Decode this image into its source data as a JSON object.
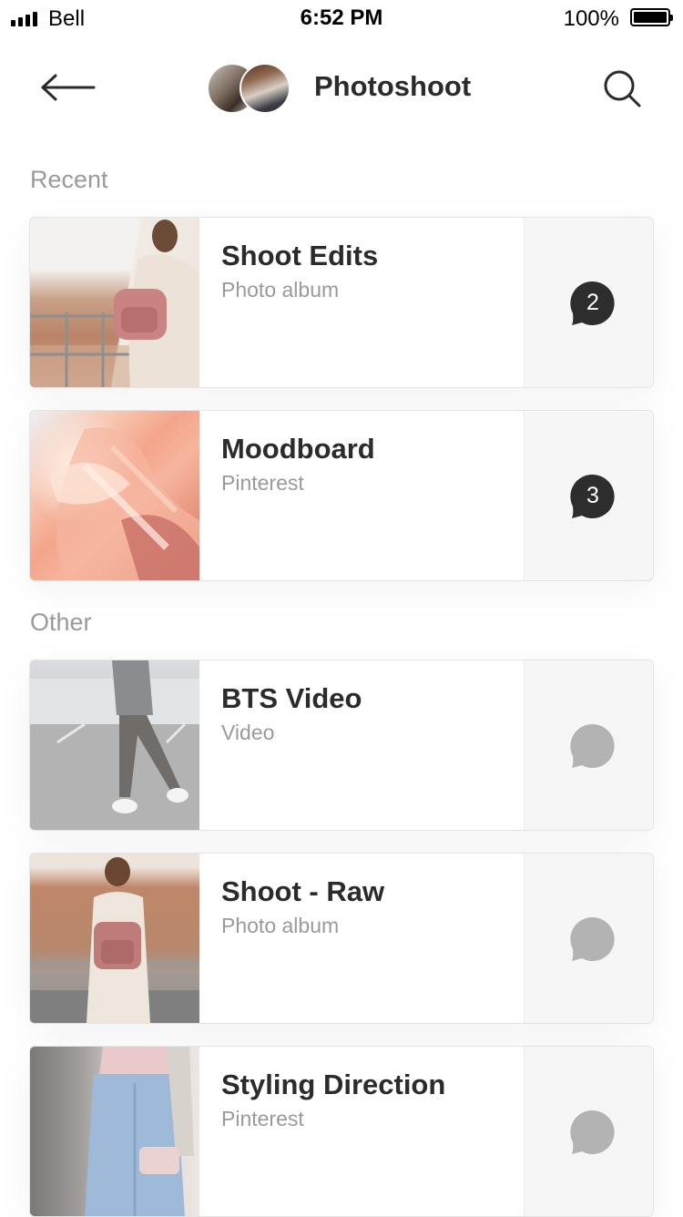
{
  "status_bar": {
    "carrier": "Bell",
    "time": "6:52 PM",
    "battery_percent_text": "100%",
    "battery_level": 1.0
  },
  "nav": {
    "back_icon": "arrow-left-icon",
    "title": "Photoshoot",
    "search_icon": "search-icon"
  },
  "sections": {
    "recent": {
      "label": "Recent",
      "items": [
        {
          "title": "Shoot Edits",
          "subtitle": "Photo album",
          "comments": "2"
        },
        {
          "title": "Moodboard",
          "subtitle": "Pinterest",
          "comments": "3"
        }
      ]
    },
    "other": {
      "label": "Other",
      "items": [
        {
          "title": "BTS Video",
          "subtitle": "Video",
          "comments": ""
        },
        {
          "title": "Shoot - Raw",
          "subtitle": "Photo album",
          "comments": ""
        },
        {
          "title": "Styling Direction",
          "subtitle": "Pinterest",
          "comments": ""
        }
      ]
    }
  },
  "colors": {
    "bubble_active": "#2d2d2d",
    "bubble_inactive": "#b3b3b3",
    "secondary_text": "#9a9a9a"
  }
}
